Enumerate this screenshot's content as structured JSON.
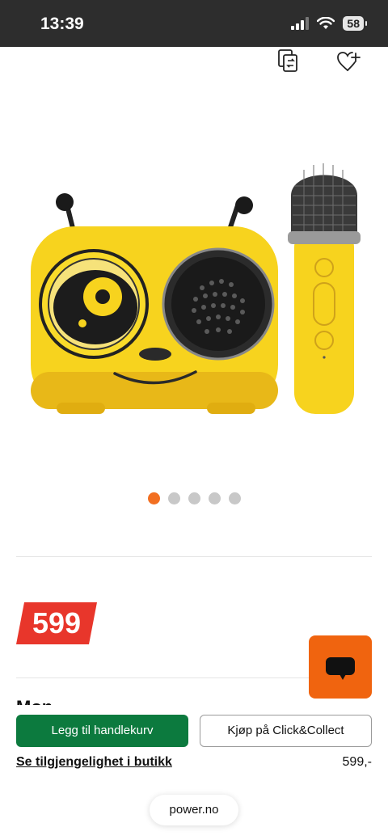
{
  "status_bar": {
    "time": "13:39",
    "battery": "58",
    "icons": [
      "cellular-signal-icon",
      "wifi-icon",
      "battery-icon"
    ]
  },
  "header_actions": {
    "icons": [
      "compare-icon",
      "wishlist-add-icon"
    ]
  },
  "product": {
    "image_icon": "bee-karaoke-speaker-with-microphone",
    "gallery_count": 5,
    "gallery_active_index": 0,
    "price_badge": "599",
    "title_partial": "Mon                                                              "
  },
  "chat": {
    "icon": "chat-bubble-icon",
    "color": "#f0640f"
  },
  "bottom_sheet": {
    "add_to_cart": "Legg til handlekurv",
    "click_collect": "Kjøp på Click&Collect",
    "store_availability": "Se tilgjengelighet i butikk",
    "price": "599,-"
  },
  "browser": {
    "url": "power.no"
  },
  "colors": {
    "accent_orange": "#f26f21",
    "cart_green": "#0c7a3e",
    "price_red": "#e8362b"
  }
}
